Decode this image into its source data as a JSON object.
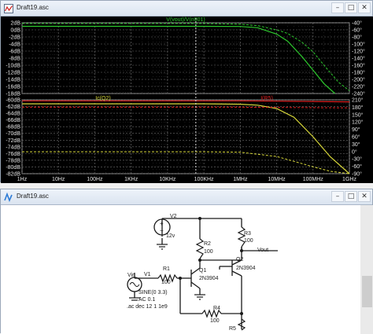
{
  "plot_window": {
    "title": "Draft19.asc",
    "controls": {
      "minimize": "–",
      "maximize": "□",
      "close": "✕"
    },
    "icon": "plot-icon"
  },
  "schematic_window": {
    "title": "Draft19.asc",
    "controls": {
      "minimize": "–",
      "maximize": "□",
      "close": "✕"
    },
    "icon": "schematic-icon"
  },
  "chart_data": [
    {
      "type": "line",
      "pane": "top",
      "trace_label": "V(vout)/V(n001)",
      "x_scale": "log",
      "xlim": [
        1,
        1000000000
      ],
      "y_left_ticks": [
        "2dB",
        "0dB",
        "-2dB",
        "-4dB",
        "-6dB",
        "-8dB",
        "-10dB",
        "-12dB",
        "-14dB",
        "-16dB",
        "-18dB"
      ],
      "y_right_ticks": [
        "-40°",
        "-60°",
        "-80°",
        "-100°",
        "-120°",
        "-140°",
        "-160°",
        "-180°",
        "-200°",
        "-220°",
        "-240°"
      ],
      "ylim_db": [
        -18,
        2
      ],
      "ylim_phase": [
        -240,
        -40
      ],
      "grid": true,
      "series": [
        {
          "name": "V(vout)/V(n001)",
          "kind": "magnitude",
          "color": "#2dc82d",
          "x": [
            1,
            10,
            100,
            1000,
            10000,
            100000,
            1000000,
            3000000,
            10000000,
            20000000,
            50000000,
            100000000,
            200000000,
            400000000
          ],
          "db": [
            1.0,
            1.0,
            1.0,
            1.0,
            1.0,
            1.0,
            0.95,
            0.6,
            -1.2,
            -3.2,
            -7.6,
            -11.4,
            -15.2,
            -18.0
          ]
        },
        {
          "name": "V(vout)/V(n001)",
          "kind": "phase",
          "color": "#2dc82d",
          "x": [
            1,
            10,
            100,
            1000,
            10000,
            100000,
            1000000,
            3000000,
            10000000,
            20000000,
            50000000,
            100000000,
            200000000,
            500000000,
            1000000000
          ],
          "deg": [
            -42,
            -42,
            -42,
            -42,
            -42,
            -42,
            -44,
            -48,
            -60,
            -70,
            -95,
            -122,
            -160,
            -208,
            -232
          ]
        }
      ]
    },
    {
      "type": "line",
      "pane": "bottom",
      "trace_labels": [
        "Ic(Q2)",
        "I(R5)"
      ],
      "x_scale": "log",
      "xlim": [
        1,
        1000000000
      ],
      "x_ticks": [
        "1Hz",
        "10Hz",
        "100Hz",
        "1KHz",
        "10KHz",
        "100KHz",
        "1MHz",
        "10MHz",
        "100MHz",
        "1GHz"
      ],
      "y_left_ticks": [
        "-60dB",
        "-62dB",
        "-64dB",
        "-66dB",
        "-68dB",
        "-70dB",
        "-72dB",
        "-74dB",
        "-76dB",
        "-78dB",
        "-80dB",
        "-82dB"
      ],
      "y_right_ticks": [
        "210°",
        "180°",
        "150°",
        "120°",
        "90°",
        "60°",
        "30°",
        "0°",
        "-30°",
        "-60°",
        "-90°"
      ],
      "ylim_db": [
        -82,
        -60
      ],
      "ylim_phase": [
        -90,
        210
      ],
      "grid": true,
      "series": [
        {
          "name": "Ic(Q2)",
          "kind": "magnitude",
          "color": "#d8d83a",
          "x": [
            1,
            10,
            100,
            1000,
            10000,
            100000,
            1000000,
            3000000,
            10000000,
            30000000,
            100000000,
            300000000,
            1000000000
          ],
          "db": [
            -61.2,
            -61.2,
            -61.2,
            -61.2,
            -61.2,
            -61.2,
            -61.3,
            -61.6,
            -62.6,
            -65.2,
            -71.0,
            -77.0,
            -82.0
          ]
        },
        {
          "name": "Ic(Q2)",
          "kind": "phase",
          "color": "#d8d83a",
          "x": [
            1,
            10,
            100,
            1000,
            10000,
            100000,
            1000000,
            10000000,
            30000000,
            100000000,
            300000000,
            1000000000
          ],
          "deg": [
            -1,
            -1,
            -1,
            -1,
            -1,
            -1,
            -3,
            -20,
            -40,
            -62,
            -80,
            -90
          ]
        },
        {
          "name": "I(R5)",
          "kind": "magnitude",
          "color": "#e02020",
          "x": [
            1,
            10,
            100,
            1000,
            10000,
            100000,
            1000000,
            10000000,
            100000000,
            1000000000
          ],
          "db": [
            -60.3,
            -60.3,
            -60.3,
            -60.3,
            -60.3,
            -60.3,
            -60.3,
            -60.4,
            -60.5,
            -60.6
          ]
        },
        {
          "name": "I(R5)",
          "kind": "phase",
          "color": "#e02020",
          "x": [
            1,
            10,
            100,
            1000,
            10000,
            100000,
            1000000,
            10000000,
            100000000,
            1000000000
          ],
          "deg": [
            180,
            180,
            180,
            180,
            180,
            180,
            180,
            179,
            178,
            177
          ]
        }
      ]
    }
  ],
  "schematic": {
    "labels": {
      "v2": "V2",
      "v2_value": "12v",
      "r3": "R3",
      "r3_value": "100",
      "r2": "R2",
      "r2_value": "100",
      "q2": "Q2",
      "q2_model": "2N3904",
      "q1": "Q1",
      "q1_model": "2N3904",
      "r1": "R1",
      "r1_value": "100",
      "v1": "V1",
      "vin": "Vin",
      "sine": "SINE(0 3.3)",
      "ac": "AC 0.1",
      "directive": ".ac dec 12 1 1e9",
      "r4": "R4",
      "r4_value": "100",
      "r5": "R5",
      "vout": "Vout"
    }
  }
}
